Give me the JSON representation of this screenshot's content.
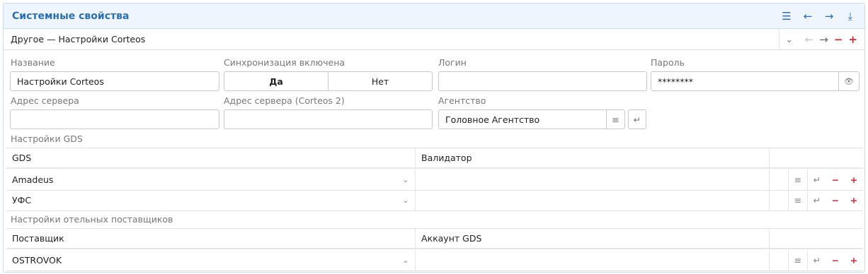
{
  "panel": {
    "title": "Системные свойства",
    "record": "Другое — Настройки Corteos"
  },
  "header_tools": [
    "list-icon",
    "arrow-left-icon",
    "arrow-right-icon",
    "collapse-icon"
  ],
  "form": {
    "name_label": "Название",
    "name_value": "Настройки Corteos",
    "sync_label": "Синхронизация включена",
    "sync_yes": "Да",
    "sync_no": "Нет",
    "sync_selected": "Да",
    "login_label": "Логин",
    "login_value": "",
    "password_label": "Пароль",
    "password_value": "********",
    "server_label": "Адрес сервера",
    "server_value": "",
    "server2_label": "Адрес сервера (Corteos 2)",
    "server2_value": "",
    "agency_label": "Агентство",
    "agency_value": "Головное Агентство"
  },
  "gds": {
    "section_label": "Настройки GDS",
    "col_gds": "GDS",
    "col_validator": "Валидатор",
    "rows": [
      {
        "gds": "Amadeus",
        "validator": ""
      },
      {
        "gds": "УФС",
        "validator": ""
      }
    ]
  },
  "hotels": {
    "section_label": "Настройки отельных поставщиков",
    "col_supplier": "Поставщик",
    "col_account": "Аккаунт GDS",
    "rows": [
      {
        "supplier": "OSTROVOK",
        "account": ""
      }
    ]
  },
  "colors": {
    "accent": "#2a6fb6",
    "danger": "#d9232e",
    "header_bg": "#eef5fc"
  }
}
